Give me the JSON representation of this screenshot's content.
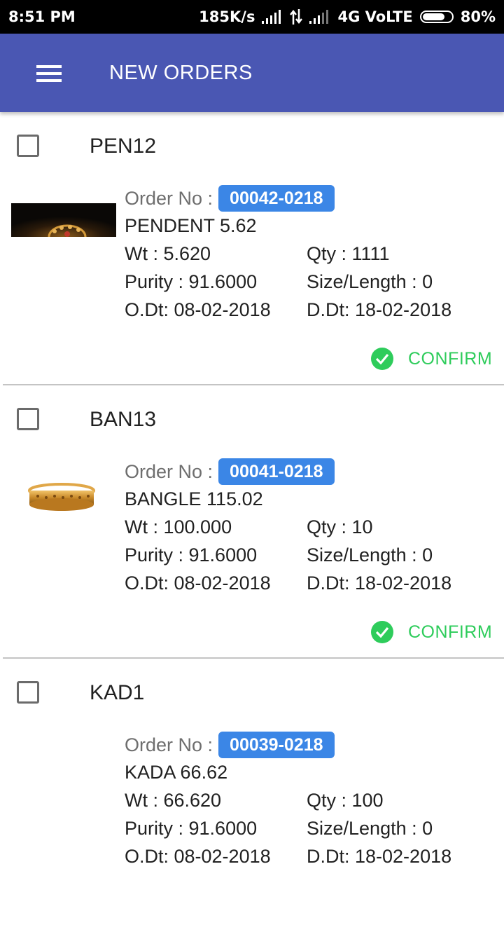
{
  "status_bar": {
    "time": "8:51 PM",
    "speed": "185K/s",
    "network": "4G VoLTE",
    "battery": "80%",
    "battery_level": 0.8
  },
  "app_bar": {
    "title": "NEW ORDERS",
    "menu_icon": "hamburger-menu-icon",
    "color": "#4a57b3"
  },
  "labels": {
    "order_no": "Order No :",
    "confirm": "CONFIRM",
    "accent": "#2ecc5b",
    "badge_color": "#3b86e6"
  },
  "orders": [
    {
      "code": "PEN12",
      "order_no": "00042-0218",
      "item": "PENDENT 5.62",
      "wt": "Wt : 5.620",
      "qty": "Qty : 1111",
      "purity": "Purity : 91.6000",
      "size": "Size/Length : 0",
      "odt": "O.Dt: 08-02-2018",
      "ddt": "D.Dt: 18-02-2018",
      "image": "pendant-thumbnail"
    },
    {
      "code": "BAN13",
      "order_no": "00041-0218",
      "item": "BANGLE 115.02",
      "wt": "Wt : 100.000",
      "qty": "Qty : 10",
      "purity": "Purity : 91.6000",
      "size": "Size/Length : 0",
      "odt": "O.Dt: 08-02-2018",
      "ddt": "D.Dt: 18-02-2018",
      "image": "bangle-thumbnail"
    },
    {
      "code": "KAD1",
      "order_no": "00039-0218",
      "item": "KADA 66.62",
      "wt": "Wt : 66.620",
      "qty": "Qty : 100",
      "purity": "Purity : 91.6000",
      "size": "Size/Length : 0",
      "odt": "O.Dt: 08-02-2018",
      "ddt": "D.Dt: 18-02-2018",
      "image": ""
    }
  ]
}
